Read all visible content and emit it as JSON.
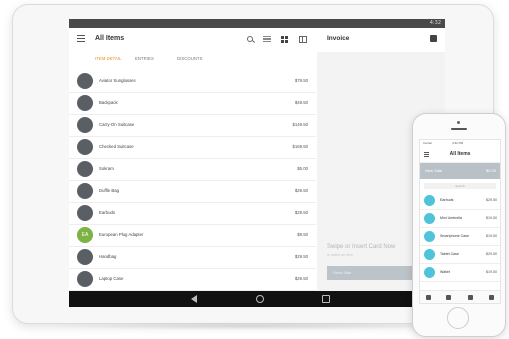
{
  "tablet": {
    "status_time": "4:32",
    "title": "All Items",
    "tabs": [
      "ITEM DETAIL",
      "ENTRIES",
      "DISCOUNTS"
    ],
    "items": [
      {
        "name": "Aviator Sunglasses",
        "price": "$79.50"
      },
      {
        "name": "Backpack",
        "price": "$49.50"
      },
      {
        "name": "Carry-On Suitcase",
        "price": "$149.50"
      },
      {
        "name": "Checked Suitcase",
        "price": "$169.50"
      },
      {
        "name": "Sokram",
        "price": "$5.00"
      },
      {
        "name": "Duffle Bag",
        "price": "$29.50"
      },
      {
        "name": "Earbuds",
        "price": "$29.50"
      },
      {
        "name": "European Plug Adapter",
        "price": "$9.50"
      },
      {
        "name": "Handbag",
        "price": "$29.50"
      },
      {
        "name": "Laptop Case",
        "price": "$29.50"
      }
    ],
    "avatar_initials": "EA",
    "invoice_title": "Invoice",
    "swipe_text": "Swipe or Insert Card Now",
    "swipe_subtext": "or select an item",
    "charge_label": "Save Sale"
  },
  "phone": {
    "status_left": "Carrier",
    "status_time": "4:32 PM",
    "title": "All Items",
    "charge_label": "New Sale",
    "charge_amount": "$0.00",
    "search_placeholder": "Search",
    "items": [
      {
        "name": "Earbuds",
        "price": "$29.50"
      },
      {
        "name": "Mini Umbrella",
        "price": "$19.50"
      },
      {
        "name": "Smartphone Case",
        "price": "$19.50"
      },
      {
        "name": "Tablet Case",
        "price": "$29.50"
      },
      {
        "name": "Wallet",
        "price": "$19.50"
      }
    ]
  },
  "colors": {
    "accent": "#e88a1a",
    "item_tint": "#4fc3da",
    "navbar": "#111111"
  }
}
